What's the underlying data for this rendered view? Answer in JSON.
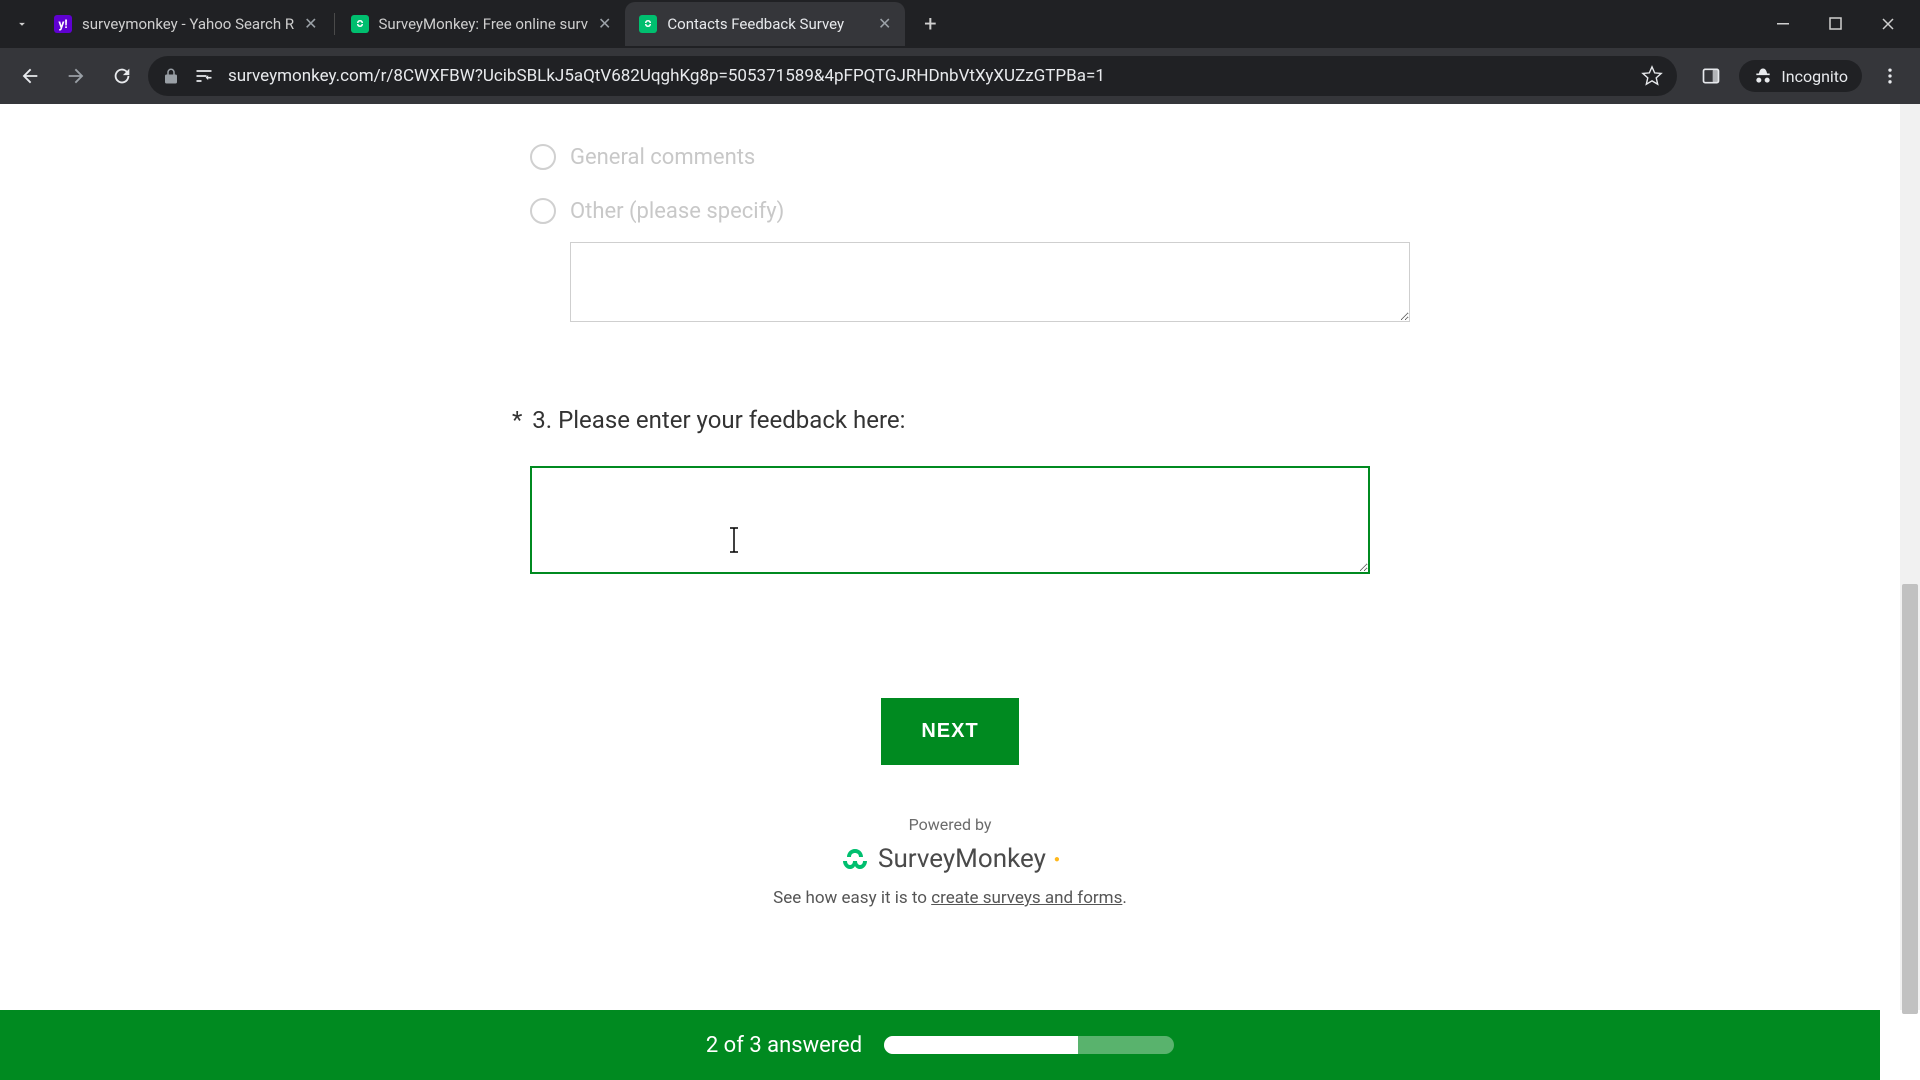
{
  "browser": {
    "tabs": [
      {
        "title": "surveymonkey - Yahoo Search R",
        "active": false,
        "favicon": "yahoo"
      },
      {
        "title": "SurveyMonkey: Free online surv",
        "active": false,
        "favicon": "sm"
      },
      {
        "title": "Contacts Feedback Survey",
        "active": true,
        "favicon": "sm"
      }
    ],
    "url": "surveymonkey.com/r/8CWXFBW?UcibSBLkJ5aQtV682UqghKg8p=505371589&4pFPQTGJRHDnbVtXyXUZzGTPBa=1",
    "incognito_label": "Incognito"
  },
  "survey": {
    "options": {
      "general": "General comments",
      "other": "Other (please specify)"
    },
    "question3": {
      "required_mark": "*",
      "number": "3.",
      "text": "Please enter your feedback here:"
    },
    "next_button": "NEXT",
    "powered_by": "Powered by",
    "brand": "SurveyMonkey",
    "tagline_prefix": "See how easy it is to ",
    "tagline_link": "create surveys and forms",
    "tagline_suffix": ".",
    "progress_text": "2 of 3 answered",
    "progress_percent": 67
  }
}
